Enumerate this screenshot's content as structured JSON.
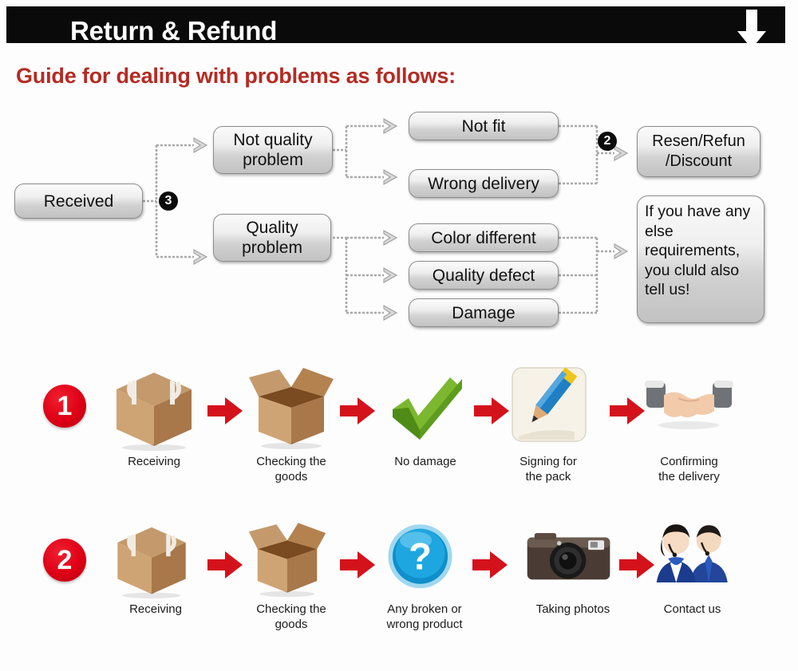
{
  "header": {
    "title": "Return & Refund",
    "down_arrow_icon": "down-arrow-icon"
  },
  "subtitle": "Guide for dealing with problems as follows:",
  "colors": {
    "header_bg": "#0a0a0a",
    "header_text": "#ffffff",
    "subtitle_red": "#b42b23",
    "badge_black": "#0b0b0b",
    "step_number_red": "#de0015",
    "arrow_red": "#d4121c",
    "node_border": "#8d8d8d",
    "wire_gray": "#a9a9a9",
    "page_bg": "#fdfdfd"
  },
  "flowchart": {
    "nodes": {
      "received": "Received",
      "not_quality_problem": "Not quality\nproblem",
      "quality_problem": "Quality\nproblem",
      "not_fit": "Not fit",
      "wrong_delivery": "Wrong delivery",
      "color_different": "Color different",
      "quality_defect": "Quality defect",
      "damage": "Damage",
      "resend_refund": "Resen/Refun\n/Discount",
      "else_note": "If you have any else requirements, you cluld also tell us!"
    },
    "badges": {
      "branch_badge": "3",
      "outcome_badge": "2"
    }
  },
  "process_rows": [
    {
      "number": "1",
      "steps": [
        {
          "icon": "closed-box-icon",
          "label": "Receiving"
        },
        {
          "icon": "open-box-icon",
          "label": "Checking the\ngoods"
        },
        {
          "icon": "green-check-icon",
          "label": "No damage"
        },
        {
          "icon": "pencil-signing-icon",
          "label": "Signing for\nthe pack"
        },
        {
          "icon": "handshake-icon",
          "label": "Confirming\nthe delivery"
        }
      ]
    },
    {
      "number": "2",
      "steps": [
        {
          "icon": "closed-box-icon",
          "label": "Receiving"
        },
        {
          "icon": "open-box-icon",
          "label": "Checking the\ngoods"
        },
        {
          "icon": "question-mark-icon",
          "label": "Any broken or\nwrong product"
        },
        {
          "icon": "camera-icon",
          "label": "Taking photos"
        },
        {
          "icon": "support-agents-icon",
          "label": "Contact us"
        }
      ]
    }
  ]
}
